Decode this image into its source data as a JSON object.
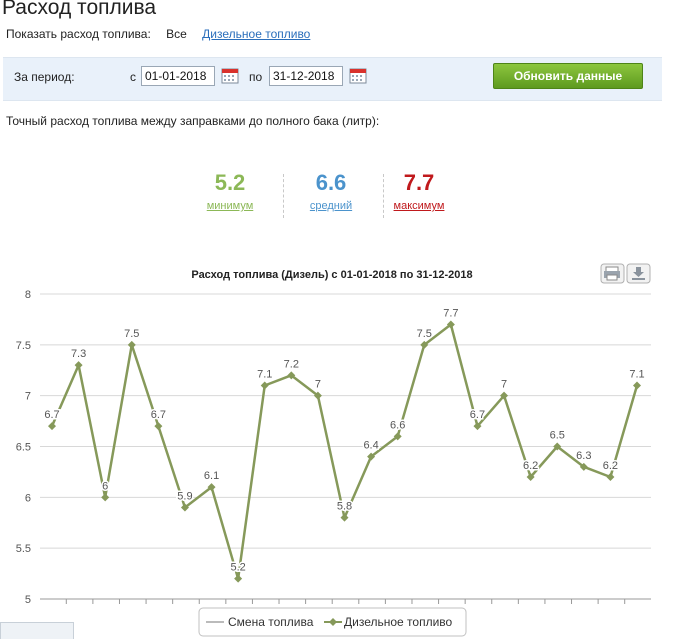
{
  "header": {
    "title": "Расход топлива",
    "show_label": "Показать расход топлива:",
    "filter_all": "Все",
    "filter_diesel": "Дизельное топливо"
  },
  "period": {
    "label": "За период:",
    "from_label": "с",
    "from_value": "01-01-2018",
    "to_label": "по",
    "to_value": "31-12-2018",
    "refresh_button": "Обновить данные"
  },
  "description": "Точный расход топлива между заправками до полного бака (литр):",
  "stats": {
    "min": {
      "value": "5.2",
      "label": "минимум",
      "color": "#8cb857"
    },
    "avg": {
      "value": "6.6",
      "label": "средний",
      "color": "#4b93cc"
    },
    "max": {
      "value": "7.7",
      "label": "максимум",
      "color": "#c0191c"
    }
  },
  "icons": [
    "calendar-icon",
    "print-icon",
    "download-icon"
  ],
  "chart_data": {
    "type": "line",
    "title": "Расход топлива (Дизель) с 01-01-2018 по 31-12-2018",
    "xlabel": "",
    "ylabel": "",
    "ylim": [
      5,
      8
    ],
    "yticks": [
      "5",
      "5.5",
      "6",
      "6.5",
      "7",
      "7.5",
      "8"
    ],
    "grid": true,
    "legend_position": "bottom-center",
    "series": [
      {
        "name": "Смена топлива",
        "color": "#bbbbbb",
        "values": []
      },
      {
        "name": "Дизельное топливо",
        "color": "#86995a",
        "values": [
          6.7,
          7.3,
          6.0,
          7.5,
          6.7,
          5.9,
          6.1,
          5.2,
          7.1,
          7.2,
          7.0,
          5.8,
          6.4,
          6.6,
          7.5,
          7.7,
          6.7,
          7.0,
          6.2,
          6.5,
          6.3,
          6.2,
          7.1
        ],
        "labels": [
          "6.7",
          "7.3",
          "6",
          "7.5",
          "6.7",
          "5.9",
          "6.1",
          "5.2",
          "7.1",
          "7.2",
          "7",
          "5.8",
          "6.4",
          "6.6",
          "7.5",
          "7.7",
          "6.7",
          "7",
          "6.2",
          "6.5",
          "6.3",
          "6.2",
          "7.1"
        ]
      }
    ]
  }
}
